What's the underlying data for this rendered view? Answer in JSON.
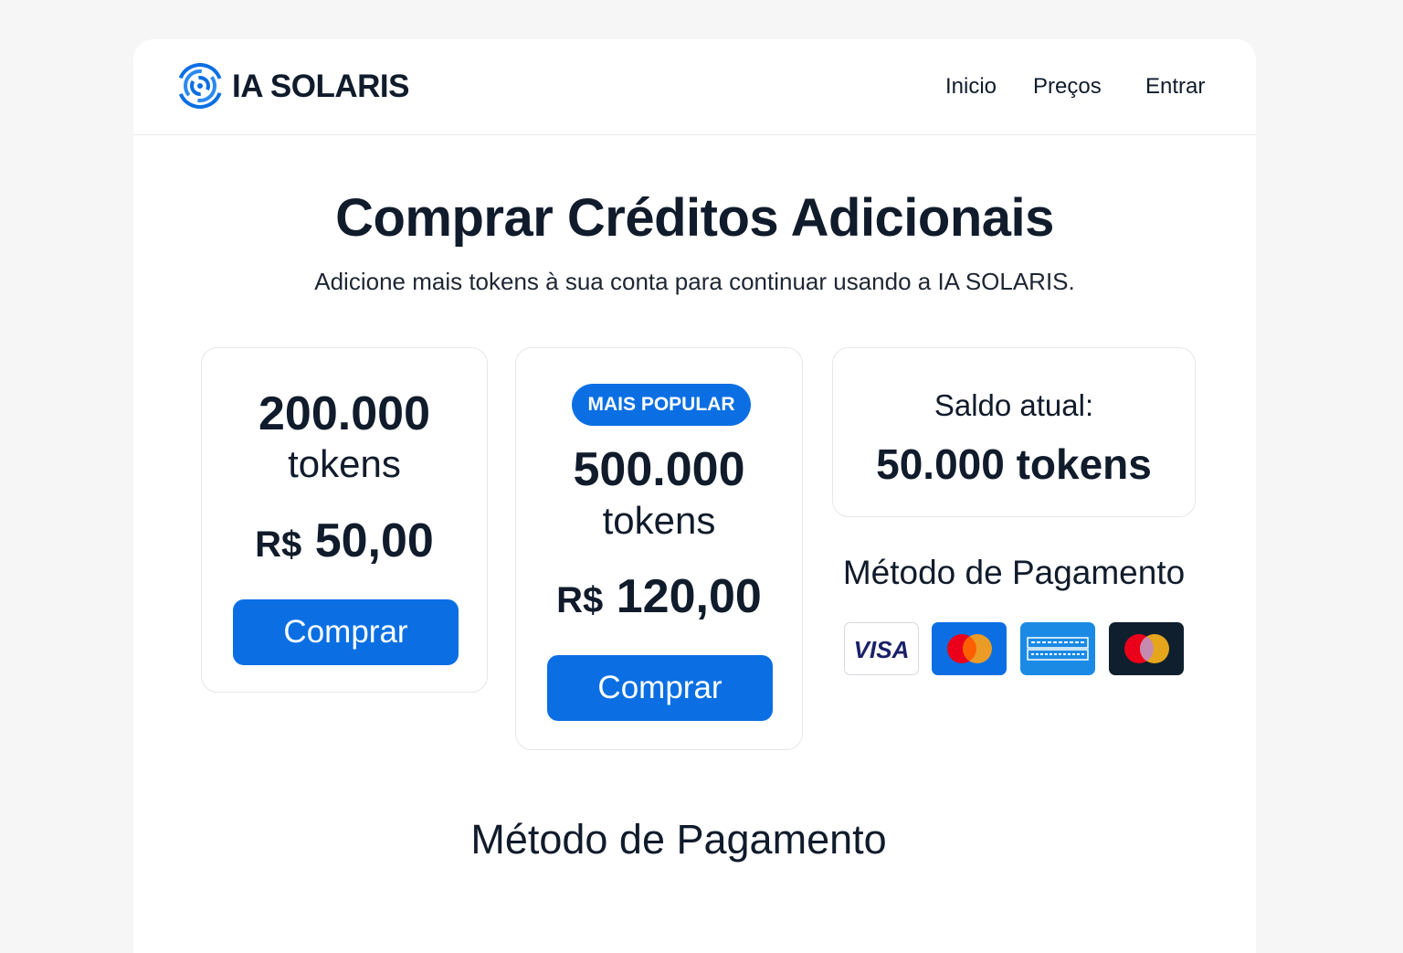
{
  "app": {
    "name": "IA SOLARIS",
    "logo_icon": "spiral-swirl-icon",
    "accent_color": "#0b6fe3"
  },
  "nav": {
    "items": [
      {
        "label": "Inicio"
      },
      {
        "label": "Preços"
      },
      {
        "label": "Entrar"
      }
    ]
  },
  "main": {
    "title": "Comprar Créditos Adicionais",
    "subtitle": "Adicione mais tokens à sua conta para continuar usando a IA SOLARIS."
  },
  "plans": [
    {
      "amount": "200.000",
      "unit": "tokens",
      "currency": "R$",
      "price": "50,00",
      "button_label": "Comprar"
    },
    {
      "badge": "MAIS POPULAR",
      "amount": "500.000",
      "unit": "tokens",
      "currency": "R$",
      "price": "120,00",
      "button_label": "Comprar"
    }
  ],
  "balance": {
    "label": "Saldo atual:",
    "value": "50.000 tokens"
  },
  "payment": {
    "title": "Método de Pagamento",
    "methods": [
      {
        "name": "visa-icon",
        "label": "VISA"
      },
      {
        "name": "mastercard-icon"
      },
      {
        "name": "amex-icon"
      },
      {
        "name": "mastercard-dark-icon"
      }
    ],
    "section_title": "Método de Pagamento"
  }
}
